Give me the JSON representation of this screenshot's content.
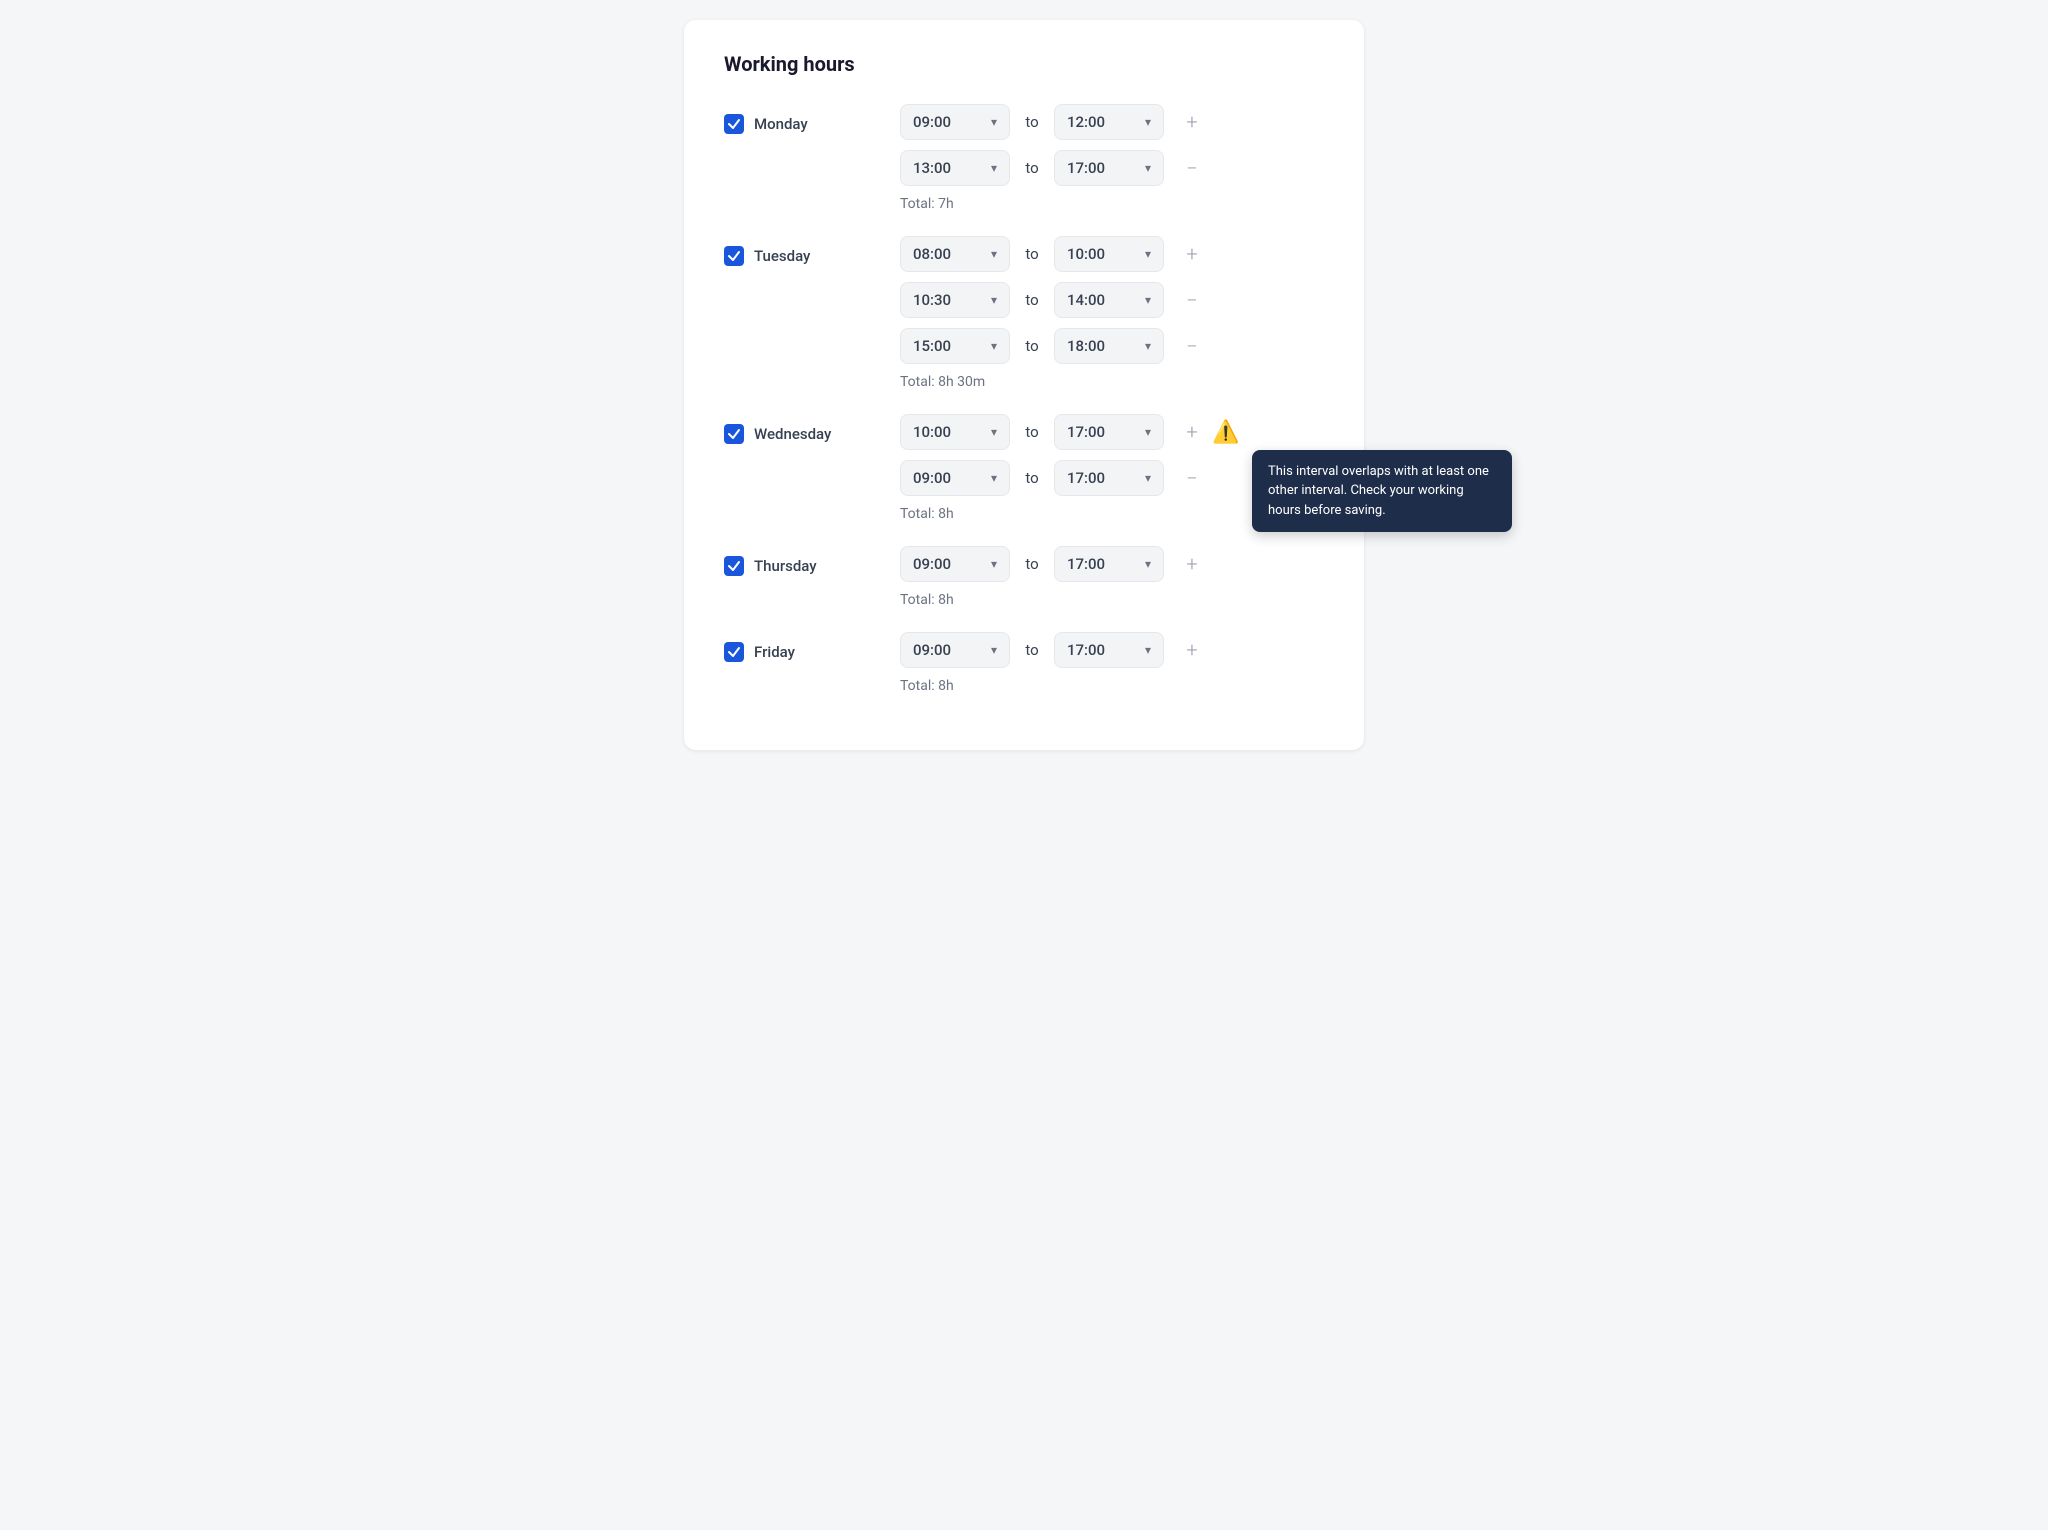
{
  "title": "Working hours",
  "days": [
    {
      "id": "monday",
      "label": "Monday",
      "checked": true,
      "intervals": [
        {
          "from": "09:00",
          "to": "12:00",
          "action": "add"
        },
        {
          "from": "13:00",
          "to": "17:00",
          "action": "remove"
        }
      ],
      "total": "Total: 7h",
      "hasWarning": false
    },
    {
      "id": "tuesday",
      "label": "Tuesday",
      "checked": true,
      "intervals": [
        {
          "from": "08:00",
          "to": "10:00",
          "action": "add"
        },
        {
          "from": "10:30",
          "to": "14:00",
          "action": "remove"
        },
        {
          "from": "15:00",
          "to": "18:00",
          "action": "remove"
        }
      ],
      "total": "Total: 8h 30m",
      "hasWarning": false
    },
    {
      "id": "wednesday",
      "label": "Wednesday",
      "checked": true,
      "intervals": [
        {
          "from": "10:00",
          "to": "17:00",
          "action": "add",
          "warning": true,
          "tooltipText": "This interval overlaps with at least one other interval. Check your working hours before saving."
        },
        {
          "from": "09:00",
          "to": "17:00",
          "action": "remove"
        }
      ],
      "total": "Total: 8h",
      "hasWarning": true
    },
    {
      "id": "thursday",
      "label": "Thursday",
      "checked": true,
      "intervals": [
        {
          "from": "09:00",
          "to": "17:00",
          "action": "add"
        }
      ],
      "total": "Total: 8h",
      "hasWarning": false
    },
    {
      "id": "friday",
      "label": "Friday",
      "checked": true,
      "intervals": [
        {
          "from": "09:00",
          "to": "17:00",
          "action": "add"
        }
      ],
      "total": "Total: 8h",
      "hasWarning": false
    }
  ],
  "labels": {
    "to": "to"
  }
}
